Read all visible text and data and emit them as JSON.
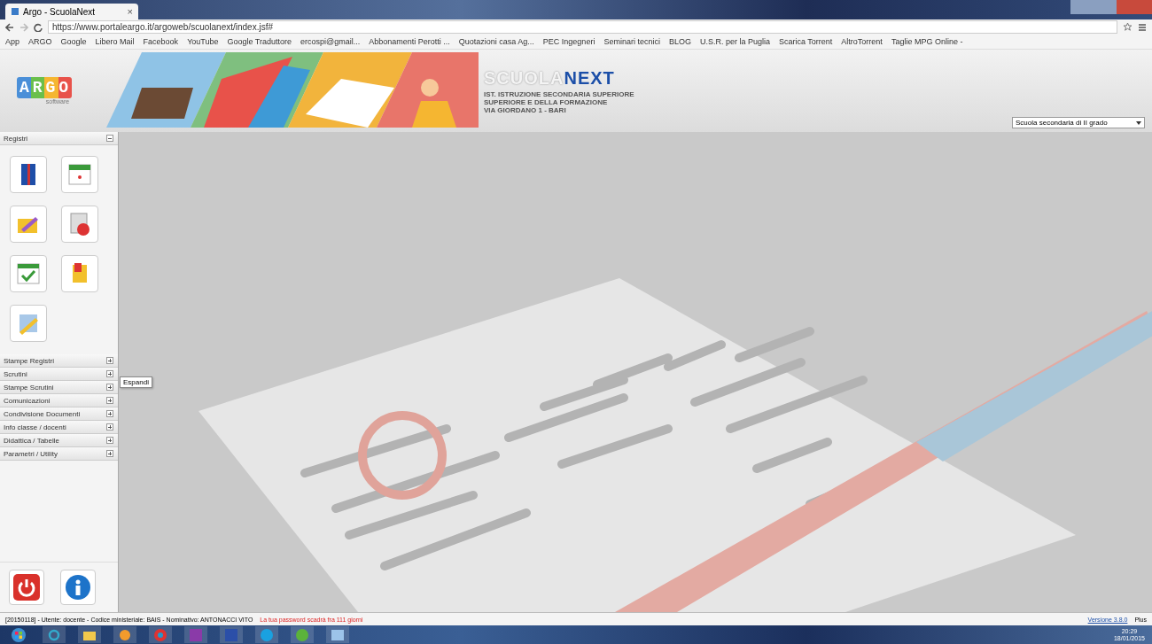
{
  "browser": {
    "tab_title": "Argo - ScuolaNext",
    "tab_close": "×",
    "url": "https://www.portaleargo.it/argoweb/scuolanext/index.jsf#",
    "bookmarks": [
      "App",
      "ARGO",
      "Google",
      "Libero Mail",
      "Facebook",
      "YouTube",
      "Google Traduttore",
      "ercospi@gmail...",
      "Abbonamenti Perotti ...",
      "Quotazioni casa Ag...",
      "PEC Ingegneri",
      "Seminari tecnici",
      "BLOG",
      "U.S.R. per la Puglia",
      "Scarica Torrent",
      "AltroTorrent",
      "Taglie MPG Online -"
    ]
  },
  "header": {
    "logo": "ARGO",
    "logo_sub": "software",
    "product_first": "SCUOLA",
    "product_second": "NEXT",
    "school_lines": [
      "IST. ISTRUZIONE SECONDARIA SUPERIORE",
      "SUPERIORE E DELLA FORMAZIONE",
      "VIA GIORDANO 1 - BARI"
    ],
    "school_select": "Scuola secondaria di II grado"
  },
  "sidebar": {
    "panel": {
      "title": "Registri",
      "expanded": true
    },
    "sections": [
      {
        "title": "Stampe Registri",
        "expanded": false
      },
      {
        "title": "Scrutini",
        "expanded": false
      },
      {
        "title": "Stampe Scrutini",
        "expanded": false
      },
      {
        "title": "Comunicazioni",
        "expanded": false
      },
      {
        "title": "Condivisione Documenti",
        "expanded": false
      },
      {
        "title": "Info classe / docenti",
        "expanded": false
      },
      {
        "title": "Didattica / Tabelle",
        "expanded": false
      },
      {
        "title": "Parametri / Utility",
        "expanded": false
      }
    ],
    "tooltip": "Espandi"
  },
  "status_bar": {
    "info": "[20150118] - Utente: docente - Codice ministeriale: BAIS - Nominativo: ANTONACCI VITO",
    "warning": "La tua password scadrà fra 111 giorni",
    "version": "Versione 3.8.0",
    "edition": "Plus"
  },
  "taskbar": {
    "time": "20:29",
    "date": "18/01/2015"
  }
}
